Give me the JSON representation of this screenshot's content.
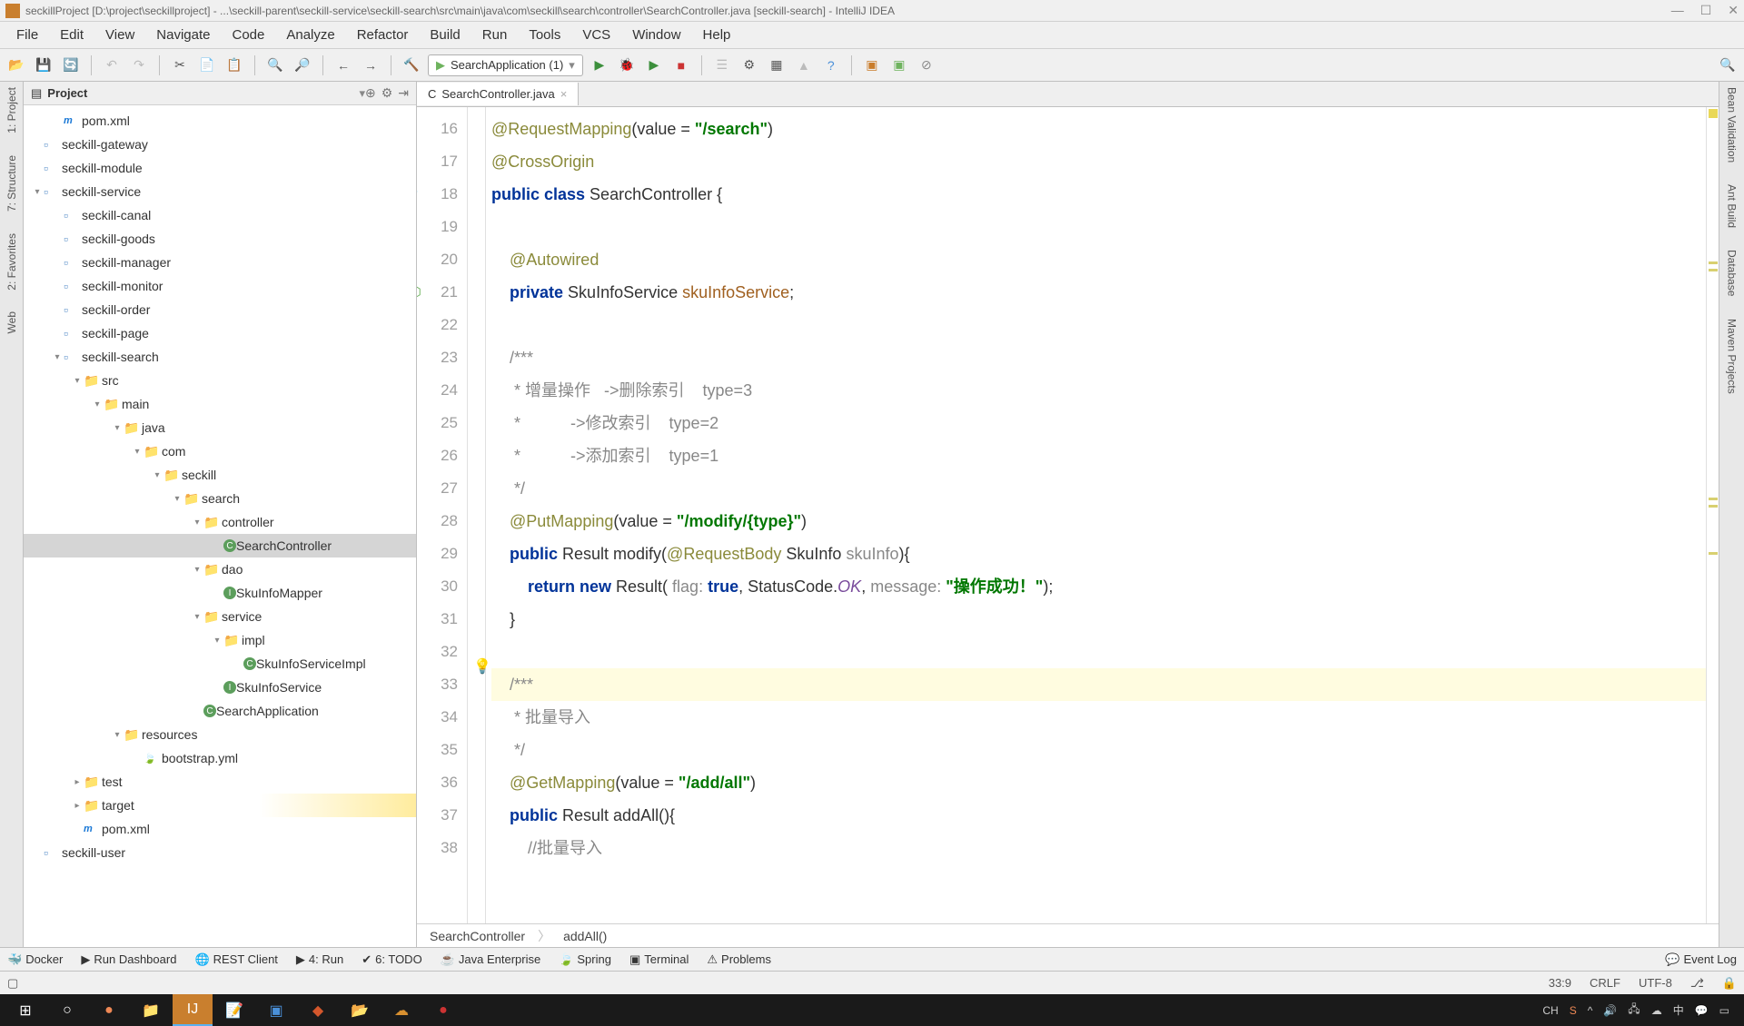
{
  "window": {
    "title": "seckillProject [D:\\project\\seckillproject] - ...\\seckill-parent\\seckill-service\\seckill-search\\src\\main\\java\\com\\seckill\\search\\controller\\SearchController.java [seckill-search] - IntelliJ IDEA"
  },
  "menu": [
    "File",
    "Edit",
    "View",
    "Navigate",
    "Code",
    "Analyze",
    "Refactor",
    "Build",
    "Run",
    "Tools",
    "VCS",
    "Window",
    "Help"
  ],
  "run_config": "SearchApplication (1)",
  "project": {
    "title": "Project",
    "tree": [
      {
        "d": 1,
        "icon": "m",
        "label": "pom.xml"
      },
      {
        "d": 0,
        "icon": "mod",
        "label": "seckill-gateway"
      },
      {
        "d": 0,
        "icon": "mod",
        "label": "seckill-module"
      },
      {
        "d": 0,
        "icon": "mod",
        "label": "seckill-service",
        "collapsed": false
      },
      {
        "d": 1,
        "icon": "mod",
        "label": "seckill-canal"
      },
      {
        "d": 1,
        "icon": "mod",
        "label": "seckill-goods"
      },
      {
        "d": 1,
        "icon": "mod",
        "label": "seckill-manager"
      },
      {
        "d": 1,
        "icon": "mod",
        "label": "seckill-monitor"
      },
      {
        "d": 1,
        "icon": "mod",
        "label": "seckill-order"
      },
      {
        "d": 1,
        "icon": "mod",
        "label": "seckill-page"
      },
      {
        "d": 1,
        "icon": "mod",
        "label": "seckill-search",
        "collapsed": false
      },
      {
        "d": 2,
        "icon": "src",
        "label": "src",
        "collapsed": false
      },
      {
        "d": 3,
        "icon": "dir",
        "label": "main",
        "collapsed": false
      },
      {
        "d": 4,
        "icon": "src",
        "label": "java",
        "collapsed": false
      },
      {
        "d": 5,
        "icon": "pkg",
        "label": "com",
        "collapsed": false
      },
      {
        "d": 6,
        "icon": "pkg",
        "label": "seckill",
        "collapsed": false
      },
      {
        "d": 7,
        "icon": "pkg",
        "label": "search",
        "collapsed": false
      },
      {
        "d": 8,
        "icon": "pkg",
        "label": "controller",
        "collapsed": false
      },
      {
        "d": 9,
        "icon": "c",
        "label": "SearchController",
        "sel": true
      },
      {
        "d": 8,
        "icon": "pkg",
        "label": "dao",
        "collapsed": false
      },
      {
        "d": 9,
        "icon": "i",
        "label": "SkuInfoMapper"
      },
      {
        "d": 8,
        "icon": "pkg",
        "label": "service",
        "collapsed": false
      },
      {
        "d": 9,
        "icon": "pkg",
        "label": "impl",
        "collapsed": false
      },
      {
        "d": 10,
        "icon": "c",
        "label": "SkuInfoServiceImpl"
      },
      {
        "d": 9,
        "icon": "i",
        "label": "SkuInfoService"
      },
      {
        "d": 8,
        "icon": "c",
        "label": "SearchApplication"
      },
      {
        "d": 4,
        "icon": "res",
        "label": "resources",
        "collapsed": false
      },
      {
        "d": 5,
        "icon": "sp",
        "label": "bootstrap.yml"
      },
      {
        "d": 2,
        "icon": "dir",
        "label": "test",
        "collapsed": true
      },
      {
        "d": 2,
        "icon": "tgt",
        "label": "target",
        "collapsed": true,
        "hl": true
      },
      {
        "d": 2,
        "icon": "m",
        "label": "pom.xml"
      },
      {
        "d": 0,
        "icon": "mod",
        "label": "seckill-user"
      }
    ]
  },
  "tab": {
    "file": "SearchController.java"
  },
  "code": {
    "start": 16,
    "lines": [
      {
        "n": 16,
        "seg": [
          {
            "t": "@RequestMapping",
            "c": "ann"
          },
          {
            "t": "(value = "
          },
          {
            "t": "\"/search\"",
            "c": "str"
          },
          {
            "t": ")"
          }
        ]
      },
      {
        "n": 17,
        "seg": [
          {
            "t": "@CrossOrigin",
            "c": "ann"
          }
        ]
      },
      {
        "n": 18,
        "seg": [
          {
            "t": "public class ",
            "c": "kw"
          },
          {
            "t": "SearchController {"
          }
        ],
        "gutter": "spring"
      },
      {
        "n": 19,
        "seg": [
          {
            "t": ""
          }
        ]
      },
      {
        "n": 20,
        "seg": [
          {
            "t": "    "
          },
          {
            "t": "@Autowired",
            "c": "ann"
          }
        ]
      },
      {
        "n": 21,
        "seg": [
          {
            "t": "    "
          },
          {
            "t": "private ",
            "c": "kw"
          },
          {
            "t": "SkuInfoService "
          },
          {
            "t": "skuInfoService",
            "c": "id"
          },
          {
            "t": ";"
          }
        ],
        "gutter": "bean"
      },
      {
        "n": 22,
        "seg": [
          {
            "t": ""
          }
        ]
      },
      {
        "n": 23,
        "seg": [
          {
            "t": "    "
          },
          {
            "t": "/***",
            "c": "cmt"
          }
        ]
      },
      {
        "n": 24,
        "seg": [
          {
            "t": "     "
          },
          {
            "t": "* 增量操作   ->删除索引    type=3",
            "c": "cmt"
          }
        ]
      },
      {
        "n": 25,
        "seg": [
          {
            "t": "     "
          },
          {
            "t": "*           ->修改索引    type=2",
            "c": "cmt"
          }
        ]
      },
      {
        "n": 26,
        "seg": [
          {
            "t": "     "
          },
          {
            "t": "*           ->添加索引    type=1",
            "c": "cmt"
          }
        ]
      },
      {
        "n": 27,
        "seg": [
          {
            "t": "     "
          },
          {
            "t": "*/",
            "c": "cmt"
          }
        ]
      },
      {
        "n": 28,
        "seg": [
          {
            "t": "    "
          },
          {
            "t": "@PutMapping",
            "c": "ann"
          },
          {
            "t": "(value = "
          },
          {
            "t": "\"/modify/{type}\"",
            "c": "str"
          },
          {
            "t": ")"
          }
        ]
      },
      {
        "n": 29,
        "seg": [
          {
            "t": "    "
          },
          {
            "t": "public ",
            "c": "kw"
          },
          {
            "t": "Result modify("
          },
          {
            "t": "@RequestBody",
            "c": "ann"
          },
          {
            "t": " SkuInfo "
          },
          {
            "t": "skuInfo",
            "c": "prm"
          },
          {
            "t": "){"
          }
        ]
      },
      {
        "n": 30,
        "seg": [
          {
            "t": "        "
          },
          {
            "t": "return new ",
            "c": "kw"
          },
          {
            "t": "Result( "
          },
          {
            "t": "flag: ",
            "c": "prm"
          },
          {
            "t": "true",
            "c": "kw"
          },
          {
            "t": ", StatusCode."
          },
          {
            "t": "OK",
            "c": "static"
          },
          {
            "t": ", "
          },
          {
            "t": "message: ",
            "c": "prm"
          },
          {
            "t": "\"操作成功！\"",
            "c": "str"
          },
          {
            "t": ");"
          }
        ]
      },
      {
        "n": 31,
        "seg": [
          {
            "t": "    }"
          }
        ]
      },
      {
        "n": 32,
        "seg": [
          {
            "t": ""
          }
        ]
      },
      {
        "n": 33,
        "cur": true,
        "seg": [
          {
            "t": "    "
          },
          {
            "t": "/***",
            "c": "cmt"
          }
        ]
      },
      {
        "n": 34,
        "seg": [
          {
            "t": "     "
          },
          {
            "t": "* 批量导入",
            "c": "cmt"
          }
        ]
      },
      {
        "n": 35,
        "seg": [
          {
            "t": "     "
          },
          {
            "t": "*/",
            "c": "cmt"
          }
        ]
      },
      {
        "n": 36,
        "seg": [
          {
            "t": "    "
          },
          {
            "t": "@GetMapping",
            "c": "ann"
          },
          {
            "t": "(value = "
          },
          {
            "t": "\"/add/all\"",
            "c": "str"
          },
          {
            "t": ")"
          }
        ]
      },
      {
        "n": 37,
        "seg": [
          {
            "t": "    "
          },
          {
            "t": "public ",
            "c": "kw"
          },
          {
            "t": "Result addAll(){"
          }
        ]
      },
      {
        "n": 38,
        "seg": [
          {
            "t": "        "
          },
          {
            "t": "//批量导入",
            "c": "cmt"
          }
        ]
      }
    ]
  },
  "breadcrumb": [
    "SearchController",
    "addAll()"
  ],
  "left_rail": [
    "1: Project",
    "7: Structure",
    "2: Favorites",
    "Web"
  ],
  "right_rail": [
    "Bean Validation",
    "Ant Build",
    "Database",
    "Maven Projects"
  ],
  "bottom_tools": [
    {
      "icon": "🐳",
      "label": "Docker"
    },
    {
      "icon": "▶",
      "label": "Run Dashboard"
    },
    {
      "icon": "🌐",
      "label": "REST Client"
    },
    {
      "icon": "▶",
      "label": "4: Run"
    },
    {
      "icon": "✔",
      "label": "6: TODO"
    },
    {
      "icon": "☕",
      "label": "Java Enterprise"
    },
    {
      "icon": "🍃",
      "label": "Spring"
    },
    {
      "icon": "▣",
      "label": "Terminal"
    },
    {
      "icon": "⚠",
      "label": "Problems"
    }
  ],
  "event_log": "Event Log",
  "status": {
    "pos": "33:9",
    "crlf": "CRLF",
    "enc": "UTF-8",
    "ctx": "⎇"
  },
  "tray": {
    "ime": "CH",
    "time": ""
  }
}
